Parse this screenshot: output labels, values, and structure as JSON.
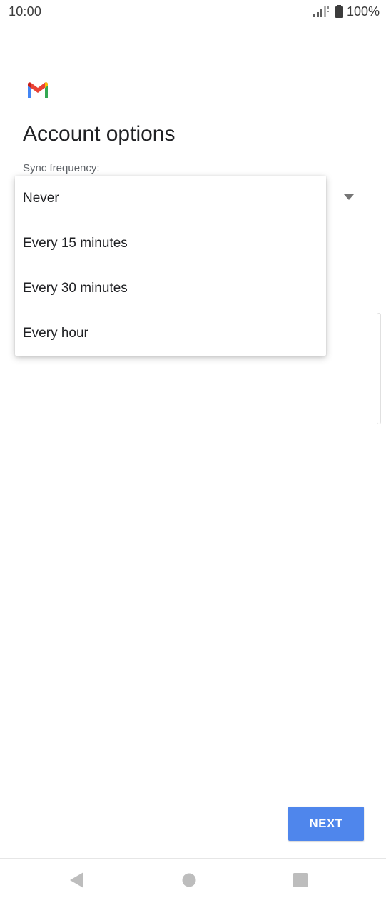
{
  "status_bar": {
    "time": "10:00",
    "battery": "100%",
    "icons": [
      "signal-icon",
      "battery-icon"
    ]
  },
  "app": {
    "logo_icon": "gmail-logo-icon",
    "title": "Account options"
  },
  "sync": {
    "label": "Sync frequency:",
    "dropdown_icon": "dropdown-arrow-icon",
    "options": [
      "Never",
      "Every 15 minutes",
      "Every 30 minutes",
      "Every hour"
    ]
  },
  "actions": {
    "next_label": "NEXT"
  },
  "nav_bar": {
    "icons": [
      "back-icon",
      "home-icon",
      "recents-icon"
    ]
  },
  "colors": {
    "accent": "#4f86ec",
    "text_primary": "#202124",
    "text_secondary": "#5f6368",
    "nav_icon": "#bdbdbd"
  }
}
